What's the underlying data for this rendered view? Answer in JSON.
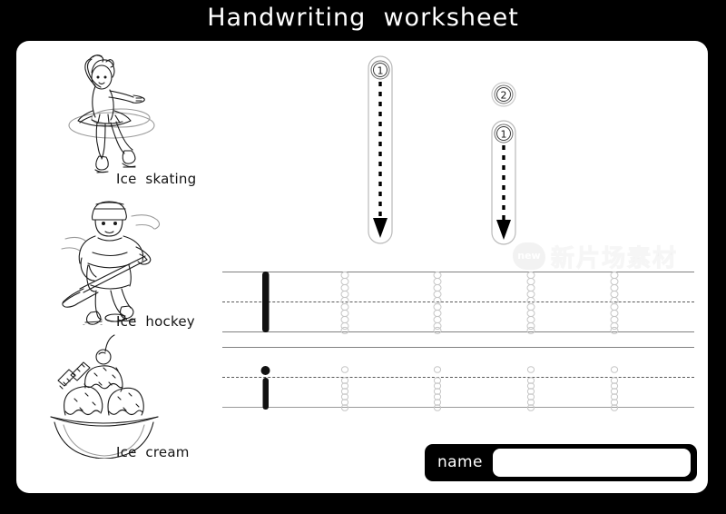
{
  "document": {
    "title": "Handwriting  worksheet",
    "letter_uppercase": "I",
    "letter_lowercase": "i",
    "background_color": "#000000",
    "page_color": "#ffffff",
    "ink_color": "#141414",
    "rule_color": "#808080"
  },
  "illustrations": [
    {
      "name": "ice-skating",
      "label": "Ice  skating",
      "icon": "ice-skater-figure"
    },
    {
      "name": "ice-hockey",
      "label": "Ice  hockey",
      "icon": "hockey-player-figure"
    },
    {
      "name": "ice-cream",
      "label": "Ice  cream",
      "icon": "ice-cream-sundae-figure"
    }
  ],
  "stroke_guides": [
    {
      "name": "uppercase-I-stroke-guide",
      "letter": "I",
      "strokes": [
        {
          "order": "1",
          "direction": "down"
        }
      ]
    },
    {
      "name": "lowercase-i-stroke-guide",
      "letter": "i",
      "strokes": [
        {
          "order": "1",
          "direction": "down"
        },
        {
          "order": "2",
          "direction": "dot"
        }
      ]
    }
  ],
  "practice_rows": [
    {
      "name": "uppercase-I-practice-row",
      "letter": "I",
      "model_count": 1,
      "trace_count": 4,
      "model_label": "I",
      "trace_label": "I"
    },
    {
      "name": "lowercase-i-practice-row",
      "letter": "i",
      "model_count": 1,
      "trace_count": 4,
      "model_label": "i",
      "trace_label": "i"
    }
  ],
  "name_field": {
    "label": "name",
    "value": "",
    "placeholder": ""
  },
  "watermark": {
    "badge": "new",
    "text": "新片场素材"
  }
}
